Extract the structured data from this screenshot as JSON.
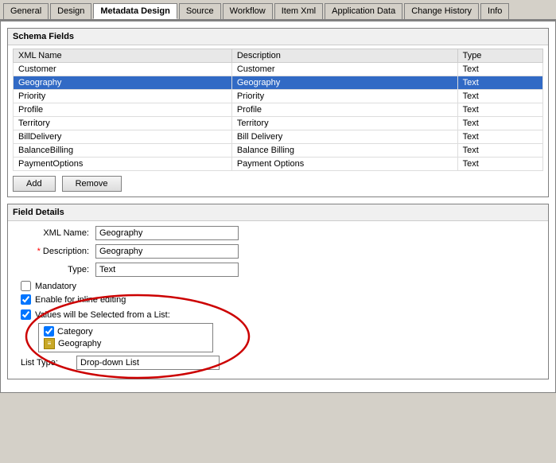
{
  "tabs": [
    {
      "id": "general",
      "label": "General",
      "active": false
    },
    {
      "id": "design",
      "label": "Design",
      "active": false
    },
    {
      "id": "metadata-design",
      "label": "Metadata Design",
      "active": true
    },
    {
      "id": "source",
      "label": "Source",
      "active": false
    },
    {
      "id": "workflow",
      "label": "Workflow",
      "active": false
    },
    {
      "id": "item-xml",
      "label": "Item Xml",
      "active": false
    },
    {
      "id": "application-data",
      "label": "Application Data",
      "active": false
    },
    {
      "id": "change-history",
      "label": "Change History",
      "active": false
    },
    {
      "id": "info",
      "label": "Info",
      "active": false
    }
  ],
  "schemaFields": {
    "title": "Schema Fields",
    "columns": [
      "XML Name",
      "Description",
      "Type"
    ],
    "rows": [
      {
        "xmlName": "Customer",
        "description": "Customer",
        "type": "Text",
        "selected": false
      },
      {
        "xmlName": "Geography",
        "description": "Geography",
        "type": "Text",
        "selected": true
      },
      {
        "xmlName": "Priority",
        "description": "Priority",
        "type": "Text",
        "selected": false
      },
      {
        "xmlName": "Profile",
        "description": "Profile",
        "type": "Text",
        "selected": false
      },
      {
        "xmlName": "Territory",
        "description": "Territory",
        "type": "Text",
        "selected": false
      },
      {
        "xmlName": "BillDelivery",
        "description": "Bill Delivery",
        "type": "Text",
        "selected": false
      },
      {
        "xmlName": "BalanceBilling",
        "description": "Balance Billing",
        "type": "Text",
        "selected": false
      },
      {
        "xmlName": "PaymentOptions",
        "description": "Payment Options",
        "type": "Text",
        "selected": false
      }
    ],
    "buttons": {
      "add": "Add",
      "remove": "Remove"
    }
  },
  "fieldDetails": {
    "title": "Field Details",
    "xmlNameLabel": "XML Name:",
    "xmlNameValue": "Geography",
    "descriptionLabel": "Description:",
    "descriptionValue": "Geography",
    "typeLabel": "Type:",
    "typeValue": "Text",
    "mandatoryLabel": "Mandatory",
    "enableInlineLabel": "Enable for inline editing",
    "valuesFromListLabel": "Values will be Selected from a List:",
    "listItems": [
      {
        "type": "checkbox",
        "label": "Category",
        "checked": true
      },
      {
        "type": "icon",
        "label": "Geography"
      }
    ],
    "listTypeLabel": "List Type:",
    "listTypeValue": "Drop-down List"
  }
}
